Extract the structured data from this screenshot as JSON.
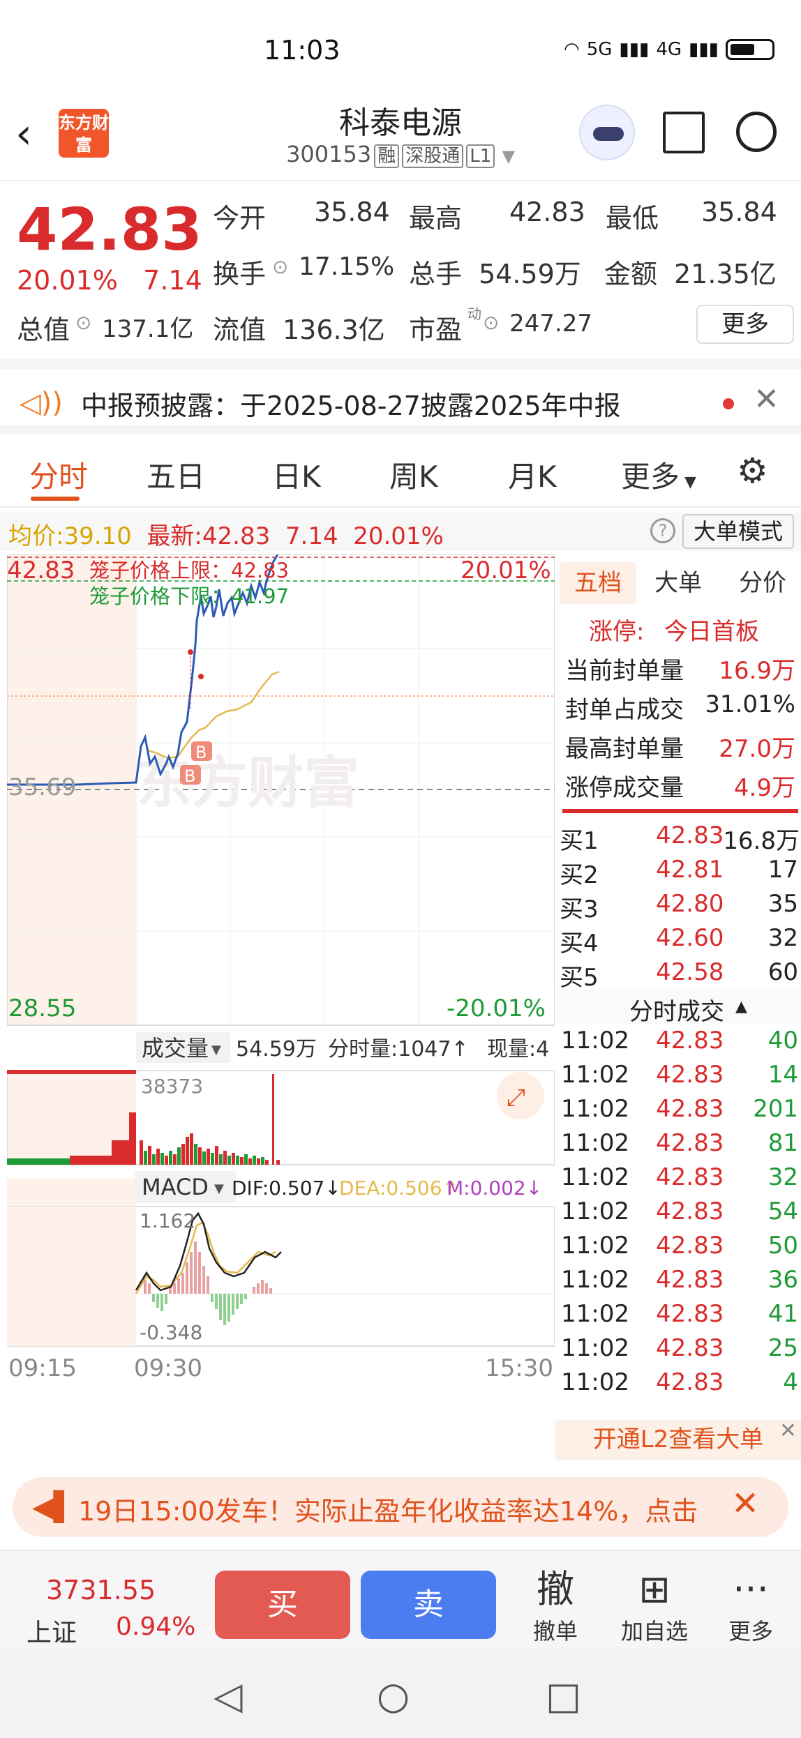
{
  "status_bar": {
    "time": "11:03",
    "signal1": "5G",
    "signal2": "4G"
  },
  "header": {
    "logo": "东方财富",
    "title": "科泰电源",
    "code": "300153",
    "tags": [
      "融",
      "深股通",
      "L1"
    ]
  },
  "quote": {
    "price": "42.83",
    "change_pct": "20.01%",
    "change": "7.14",
    "open_label": "今开",
    "open": "35.84",
    "high_label": "最高",
    "high": "42.83",
    "low_label": "最低",
    "low": "35.84",
    "turnover_label": "换手",
    "turnover": "17.15%",
    "volume_label": "总手",
    "volume": "54.59万",
    "amount_label": "金额",
    "amount": "21.35亿",
    "mktcap_label": "总值",
    "mktcap": "137.1亿",
    "float_label": "流值",
    "float": "136.3亿",
    "pe_label": "市盈",
    "pe_sup": "动",
    "pe": "247.27",
    "more": "更多"
  },
  "notice": {
    "text": "中报预披露：于2025-08-27披露2025年中报"
  },
  "tabs": [
    "分时",
    "五日",
    "日K",
    "周K",
    "月K",
    "更多"
  ],
  "info": {
    "avg_label": "均价:",
    "avg": "39.10",
    "latest_label": "最新:",
    "latest": "42.83",
    "chg": "7.14",
    "pct": "20.01%",
    "mode": "大单模式"
  },
  "chart": {
    "price_top": "42.83",
    "pct_top": "20.01%",
    "price_bottom": "28.55",
    "pct_bottom": "-20.01%",
    "prev_close": "35.69",
    "cage_upper": "笼子价格上限：42.83",
    "cage_lower": "笼子价格下限：41.97",
    "watermark": "东方财富",
    "volume_label": "成交量",
    "volume_total": "54.59万",
    "volume_min": "分时量:1047↑",
    "volume_now": "现量:4",
    "volume_max": "38373",
    "macd_label": "MACD",
    "dif": "DIF:0.507↓",
    "dea": "DEA:0.506↑",
    "m": "M:0.002↓",
    "macd_max": "1.162",
    "macd_min": "-0.348",
    "time_start": "09:15",
    "time_open": "09:30",
    "time_end": "15:30",
    "marker": "B"
  },
  "side": {
    "tabs": [
      "五档",
      "大单",
      "分价"
    ],
    "limit_label": "涨停:",
    "limit_val": "今日首板",
    "stats": [
      {
        "label": "当前封单量",
        "value": "16.9万"
      },
      {
        "label": "封单占成交",
        "value": "31.01%"
      },
      {
        "label": "最高封单量",
        "value": "27.0万"
      },
      {
        "label": "涨停成交量",
        "value": "4.9万"
      }
    ],
    "orderbook": [
      {
        "name": "买1",
        "price": "42.83",
        "vol": "16.8万"
      },
      {
        "name": "买2",
        "price": "42.81",
        "vol": "17"
      },
      {
        "name": "买3",
        "price": "42.80",
        "vol": "35"
      },
      {
        "name": "买4",
        "price": "42.60",
        "vol": "32"
      },
      {
        "name": "买5",
        "price": "42.58",
        "vol": "60"
      }
    ],
    "trades_title": "分时成交",
    "trades": [
      {
        "t": "11:02",
        "p": "42.83",
        "v": "40"
      },
      {
        "t": "11:02",
        "p": "42.83",
        "v": "14"
      },
      {
        "t": "11:02",
        "p": "42.83",
        "v": "201"
      },
      {
        "t": "11:02",
        "p": "42.83",
        "v": "81"
      },
      {
        "t": "11:02",
        "p": "42.83",
        "v": "32"
      },
      {
        "t": "11:02",
        "p": "42.83",
        "v": "54"
      },
      {
        "t": "11:02",
        "p": "42.83",
        "v": "50"
      },
      {
        "t": "11:02",
        "p": "42.83",
        "v": "36"
      },
      {
        "t": "11:02",
        "p": "42.83",
        "v": "41"
      },
      {
        "t": "11:02",
        "p": "42.83",
        "v": "25"
      },
      {
        "t": "11:02",
        "p": "42.83",
        "v": "4"
      }
    ],
    "l2": "开通L2查看大单"
  },
  "ad": {
    "text": "19日15:00发车！实际止盈年化收益率达14%，点击"
  },
  "bottom": {
    "index_value": "3731.55",
    "index_name": "上证",
    "index_pct": "0.94%",
    "buy": "买",
    "sell": "卖",
    "cancel_glyph": "撤",
    "cancel": "撤单",
    "add": "加自选",
    "more": "更多"
  },
  "colors": {
    "up": "#d92b2b",
    "down": "#1e9a37",
    "accent": "#e0521d",
    "buy_btn": "#e25a52",
    "sell_btn": "#4b7cf0"
  }
}
